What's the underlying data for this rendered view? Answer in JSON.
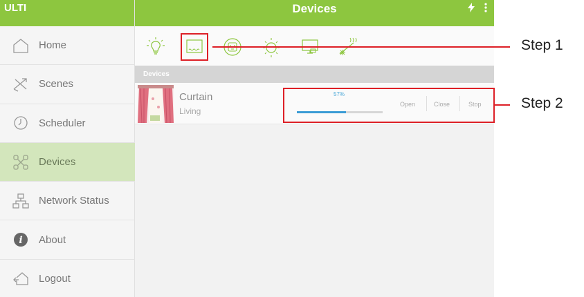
{
  "app": {
    "brand": "ULTI",
    "header_title": "Devices",
    "header_icons": [
      "lightning-icon",
      "more-vertical-icon"
    ],
    "accent_color": "#8dc63f",
    "highlight_color": "#dd1f26"
  },
  "sidebar": {
    "items": [
      {
        "label": "Home",
        "icon": "home-icon",
        "active": false
      },
      {
        "label": "Scenes",
        "icon": "scenes-icon",
        "active": false
      },
      {
        "label": "Scheduler",
        "icon": "clock-icon",
        "active": false
      },
      {
        "label": "Devices",
        "icon": "devices-icon",
        "active": true
      },
      {
        "label": "Network Status",
        "icon": "network-icon",
        "active": false
      },
      {
        "label": "About",
        "icon": "info-icon",
        "active": false
      },
      {
        "label": "Logout",
        "icon": "logout-icon",
        "active": false
      }
    ]
  },
  "categories": [
    {
      "icon": "light-bulb-icon",
      "selected": false
    },
    {
      "icon": "curtain-icon",
      "selected": true
    },
    {
      "icon": "outlet-icon",
      "selected": false
    },
    {
      "icon": "dimmer-icon",
      "selected": false
    },
    {
      "icon": "tv-icon",
      "selected": false
    },
    {
      "icon": "ac-icon",
      "selected": false
    }
  ],
  "devices": {
    "section_title": "Devices",
    "items": [
      {
        "name": "Curtain",
        "room": "Living",
        "percent_label": "57%",
        "progress": 0.57,
        "controls": [
          "Open",
          "Close",
          "Stop"
        ]
      }
    ]
  },
  "annotations": {
    "step1": "Step 1",
    "step2": "Step 2"
  }
}
